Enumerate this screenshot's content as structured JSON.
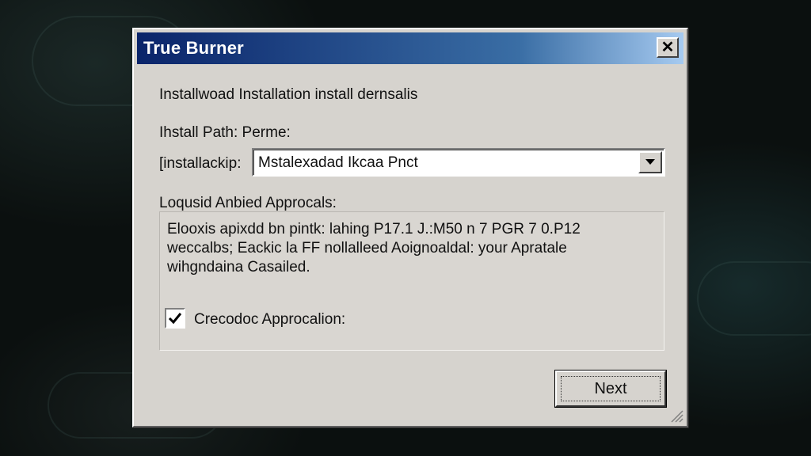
{
  "window": {
    "title": "True Burner",
    "close_glyph": "✕"
  },
  "content": {
    "heading": "Installwoad Installation  install dernsalis",
    "path_label": "Ihstall Path: Perme:",
    "path_row_label": "[installackip:",
    "path_value": "Mstalexadad Ikcaa Pnct",
    "approvals_label": "Loqusid Anbied Approcals:",
    "description_lines": [
      "Elooxis apixdd bn pintk: lahing P17.1 J.:M50 n 7 PGR 7 0.P12",
      "weccalbs; Eackic la FF nollalleed Aoignoaldal: your Apratale",
      "wihgndaina Casailed."
    ],
    "checkbox_label": "Crecodoc Approcalion:",
    "checkbox_checked": true,
    "next_label": "Next"
  },
  "icons": {
    "close": "close-icon",
    "dropdown": "chevron-down-icon",
    "check": "checkmark-icon",
    "resize": "resize-grip-icon"
  }
}
